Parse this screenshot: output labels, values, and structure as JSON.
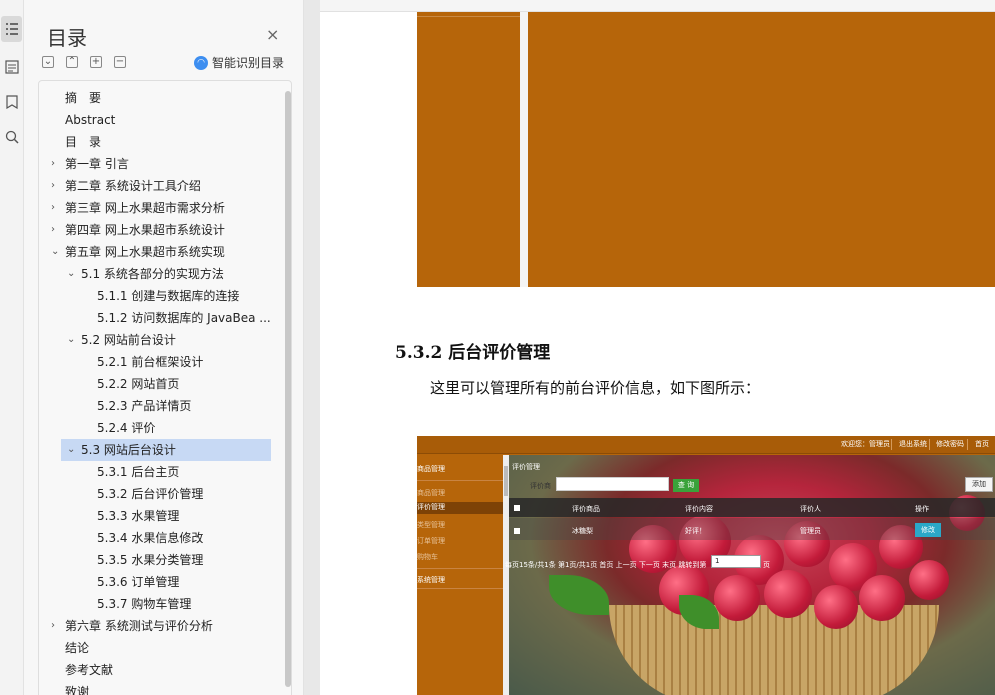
{
  "toc": {
    "title": "目录",
    "close": "×",
    "controls": [
      "⌄",
      "⌃",
      "+",
      "−"
    ],
    "smart_label": "智能识别目录",
    "items": [
      {
        "label": "摘　要"
      },
      {
        "label": "Abstract"
      },
      {
        "label": "目　录"
      },
      {
        "label": "第一章  引言",
        "chev": "›"
      },
      {
        "label": "第二章  系统设计工具介绍",
        "chev": "›"
      },
      {
        "label": "第三章  网上水果超市需求分析",
        "chev": "›"
      },
      {
        "label": "第四章  网上水果超市系统设计",
        "chev": "›"
      },
      {
        "label": "第五章  网上水果超市系统实现",
        "chev": "⌄"
      },
      {
        "label": "5.1  系统各部分的实现方法",
        "chev": "⌄"
      },
      {
        "label": "5.1.1  创建与数据库的连接"
      },
      {
        "label": "5.1.2  访问数据库的 JavaBea ..."
      },
      {
        "label": "5.2  网站前台设计",
        "chev": "⌄"
      },
      {
        "label": "5.2.1 前台框架设计"
      },
      {
        "label": "5.2.2  网站首页"
      },
      {
        "label": "5.2.3  产品详情页"
      },
      {
        "label": "5.2.4  评价"
      },
      {
        "label": "5.3 网站后台设计",
        "chev": "⌄"
      },
      {
        "label": "5.3.1  后台主页"
      },
      {
        "label": "5.3.2  后台评价管理"
      },
      {
        "label": "5.3.3  水果管理"
      },
      {
        "label": "5.3.4 水果信息修改"
      },
      {
        "label": "5.3.5  水果分类管理"
      },
      {
        "label": "5.3.6  订单管理"
      },
      {
        "label": "5.3.7  购物车管理"
      },
      {
        "label": "第六章  系统测试与评价分析",
        "chev": "›"
      },
      {
        "label": "结论"
      },
      {
        "label": "参考文献"
      },
      {
        "label": "致谢"
      }
    ]
  },
  "doc": {
    "heading": "5.3.2 后台评价管理",
    "paragraph": "这里可以管理所有的前台评价信息，如下图所示："
  },
  "screenshot": {
    "top_links": [
      "欢迎您：管理员",
      "退出系统",
      "修改密码",
      "首页"
    ],
    "side_items": [
      "商品管理",
      "商品管理",
      "评价管理",
      "类型管理",
      "订单管理",
      "购物车",
      "系统管理"
    ],
    "panel_title": "评价管理",
    "search_label": "评价商",
    "search_button": "查 询",
    "add_button": "添加",
    "headers": [
      "评价商品",
      "评价内容",
      "评价人",
      "操作"
    ],
    "row": {
      "product": "冰糖梨",
      "content": "好评！",
      "person": "管理员",
      "action": "修改"
    },
    "pager": "每页15条/共1条 第1页/共1页 首页 上一页 下一页 末页 跳转到第",
    "pager_select": "1",
    "pager_suffix": "页"
  }
}
